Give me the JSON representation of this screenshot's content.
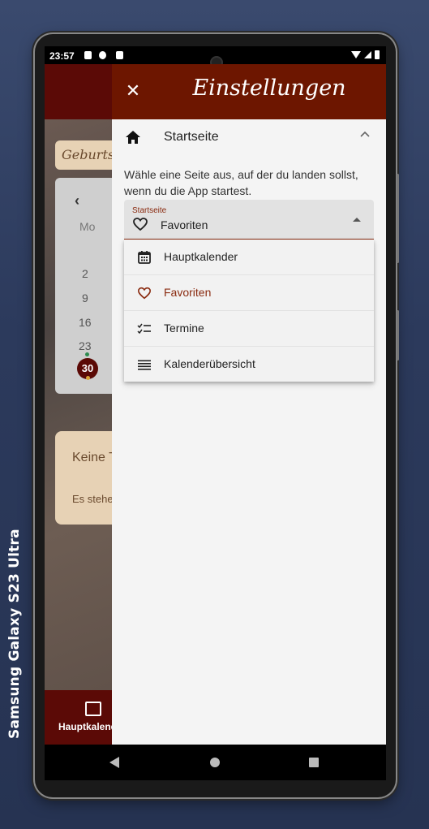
{
  "device": {
    "label": "Samsung Galaxy  S23 Ultra"
  },
  "statusbar": {
    "time": "23:57"
  },
  "background_app": {
    "pill_text": "Geburtst",
    "calendar": {
      "weekday": "Mo",
      "days": [
        "2",
        "9",
        "16",
        "23"
      ],
      "today": "30"
    },
    "card": {
      "title": "Keine T",
      "subtitle": "Es stehe"
    },
    "nav_label": "Hauptkalend"
  },
  "settings": {
    "title": "Einstellungen",
    "section": {
      "title": "Startseite",
      "description": "Wähle eine Seite aus, auf der du landen sollst, wenn du die App startest.",
      "select": {
        "label": "Startseite",
        "value": "Favoriten"
      },
      "options": [
        {
          "label": "Hauptkalender",
          "icon": "calendar-icon"
        },
        {
          "label": "Favoriten",
          "icon": "heart-icon",
          "selected": true
        },
        {
          "label": "Termine",
          "icon": "checklist-icon"
        },
        {
          "label": "Kalenderübersicht",
          "icon": "list-icon"
        }
      ]
    },
    "accent_color": "#6d1600",
    "selected_color": "#8a2b10"
  }
}
